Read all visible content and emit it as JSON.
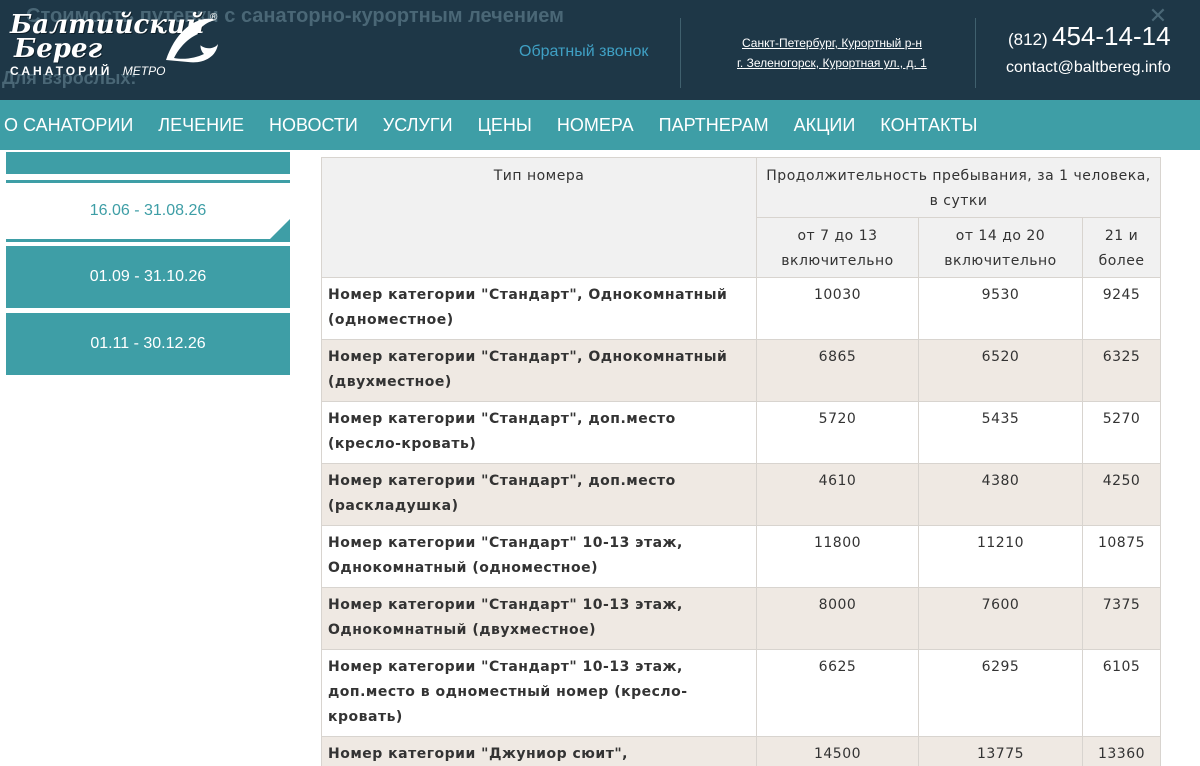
{
  "header": {
    "background_text": "Стоимость путевки с санаторно-курортным лечением",
    "background_text_2": "Для взрослых:",
    "logo": {
      "line1": "Балтийский",
      "line2": "Берег",
      "line3": "САНАТОРИЙ",
      "metro": "МЕТРО",
      "reg": "®"
    },
    "callback_label": "Обратный звонок",
    "address_line1": "Санкт-Петербург, Курортный р-н",
    "address_line2": "г. Зеленогорск, Курортная ул., д. 1",
    "phone_prefix": "(812)",
    "phone_main": "454-14-14",
    "email": "contact@baltbereg.info",
    "close_glyph": "✕"
  },
  "nav": {
    "items": [
      {
        "label": "О САНАТОРИИ"
      },
      {
        "label": "ЛЕЧЕНИЕ"
      },
      {
        "label": "НОВОСТИ"
      },
      {
        "label": "УСЛУГИ"
      },
      {
        "label": "ЦЕНЫ"
      },
      {
        "label": "НОМЕРА"
      },
      {
        "label": "ПАРТНЕРАМ"
      },
      {
        "label": "АКЦИИ"
      },
      {
        "label": "КОНТАКТЫ"
      }
    ]
  },
  "sidebar": {
    "active_tab": "16.06 - 31.08.26",
    "tabs": [
      {
        "label": "01.09 - 31.10.26"
      },
      {
        "label": "01.11 - 30.12.26"
      }
    ]
  },
  "table": {
    "col_type_header": "Тип номера",
    "duration_header": "Продолжительность пребывания, за 1 человека, в сутки",
    "sub_headers": [
      "от 7 до 13 включительно",
      "от 14 до 20 включительно",
      "21 и более"
    ],
    "rows": [
      {
        "name": "Номер категории \"Стандарт\", Однокомнатный (одноместное)",
        "v1": "10030",
        "v2": "9530",
        "v3": "9245"
      },
      {
        "name": "Номер категории \"Стандарт\", Однокомнатный (двухместное)",
        "v1": "6865",
        "v2": "6520",
        "v3": "6325"
      },
      {
        "name": "Номер категории \"Стандарт\", доп.место (кресло-кровать)",
        "v1": "5720",
        "v2": "5435",
        "v3": "5270"
      },
      {
        "name": "Номер категории \"Стандарт\", доп.место (раскладушка)",
        "v1": "4610",
        "v2": "4380",
        "v3": "4250"
      },
      {
        "name": "Номер категории \"Стандарт\" 10-13 этаж, Однокомнатный (одноместное)",
        "v1": "11800",
        "v2": "11210",
        "v3": "10875"
      },
      {
        "name": "Номер категории \"Стандарт\" 10-13 этаж, Однокомнатный (двухместное)",
        "v1": "8000",
        "v2": "7600",
        "v3": "7375"
      },
      {
        "name": "Номер категории \"Стандарт\" 10-13 этаж, доп.место в одноместный номер (кресло-кровать)",
        "v1": "6625",
        "v2": "6295",
        "v3": "6105"
      },
      {
        "name": "Номер категории \"Джуниор сюит\", Однокомнатный (одноместное)",
        "v1": "14500",
        "v2": "13775",
        "v3": "13360"
      }
    ]
  },
  "colors": {
    "header_bg": "#1e3747",
    "accent": "#3e9ea6",
    "row_alt": "#efe9e3",
    "link_blue": "#3fa0c4"
  }
}
